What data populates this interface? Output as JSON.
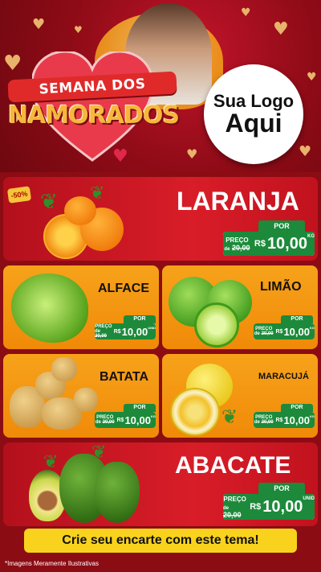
{
  "header": {
    "title_line1": "SEMANA DOS",
    "title_line2": "NAMORADOS",
    "logo_line1": "Sua Logo",
    "logo_line2": "Aqui"
  },
  "discount_badge": "-50%",
  "products": {
    "laranja": {
      "name": "LARANJA",
      "por": "POR",
      "preco": "PREÇO",
      "de": "de",
      "old": "20,00",
      "currency": "R$",
      "price": "10,00",
      "unit": "KG"
    },
    "alface": {
      "name": "ALFACE",
      "por": "POR",
      "preco": "PREÇO",
      "de": "de",
      "old": "20,00",
      "currency": "R$",
      "price": "10,00",
      "unit": "UNID"
    },
    "limao": {
      "name": "LIMÃO",
      "por": "POR",
      "preco": "PREÇO",
      "de": "de",
      "old": "20,00",
      "currency": "R$",
      "price": "10,00",
      "unit": "KG"
    },
    "batata": {
      "name": "BATATA",
      "por": "POR",
      "preco": "PREÇO",
      "de": "de",
      "old": "20,00",
      "currency": "R$",
      "price": "10,00",
      "unit": "KG"
    },
    "maracuja": {
      "name": "MARACUJÁ",
      "por": "POR",
      "preco": "PREÇO",
      "de": "de",
      "old": "20,00",
      "currency": "R$",
      "price": "10,00",
      "unit": "KG"
    },
    "abacate": {
      "name": "ABACATE",
      "por": "POR",
      "preco": "PREÇO",
      "de": "de",
      "old": "20,00",
      "currency": "R$",
      "price": "10,00",
      "unit": "UNID"
    }
  },
  "cta": "Crie seu encarte com este tema!",
  "footnote": "*Imagens Meramente Ilustrativas",
  "colors": {
    "background": "#8c0c14",
    "card_red": "#d81d28",
    "card_orange": "#f7a21a",
    "price_green": "#1c8a3a",
    "cta_yellow": "#f8d21c",
    "title_gold": "#f6b73c"
  }
}
